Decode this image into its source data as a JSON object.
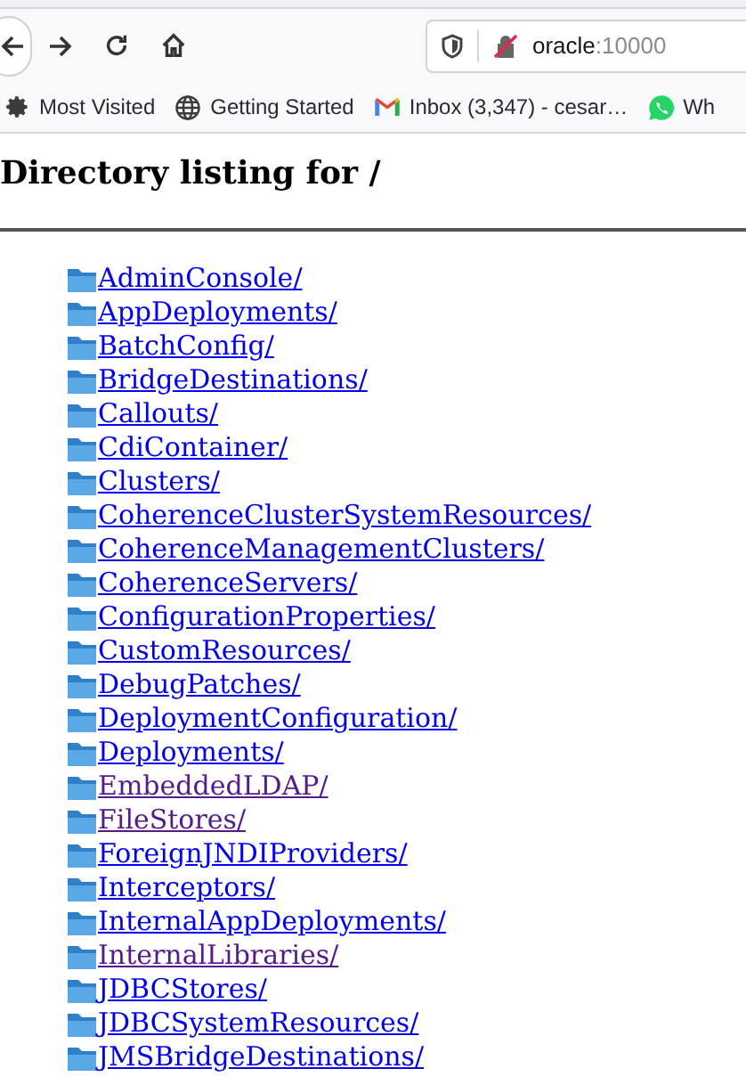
{
  "address_bar": {
    "host": "oracle",
    "port": ":10000"
  },
  "bookmarks": [
    {
      "kind": "gear",
      "label": "Most Visited"
    },
    {
      "kind": "globe",
      "label": "Getting Started"
    },
    {
      "kind": "mail",
      "label": "Inbox (3,347) - cesar…"
    },
    {
      "kind": "chat",
      "label": "Wh"
    }
  ],
  "heading": "Directory listing for /",
  "entries": [
    {
      "name": "AdminConsole/",
      "visited": false
    },
    {
      "name": "AppDeployments/",
      "visited": false
    },
    {
      "name": "BatchConfig/",
      "visited": false
    },
    {
      "name": "BridgeDestinations/",
      "visited": false
    },
    {
      "name": "Callouts/",
      "visited": false
    },
    {
      "name": "CdiContainer/",
      "visited": false
    },
    {
      "name": "Clusters/",
      "visited": false
    },
    {
      "name": "CoherenceClusterSystemResources/",
      "visited": false
    },
    {
      "name": "CoherenceManagementClusters/",
      "visited": false
    },
    {
      "name": "CoherenceServers/",
      "visited": false
    },
    {
      "name": "ConfigurationProperties/",
      "visited": false
    },
    {
      "name": "CustomResources/",
      "visited": false
    },
    {
      "name": "DebugPatches/",
      "visited": false
    },
    {
      "name": "DeploymentConfiguration/",
      "visited": false
    },
    {
      "name": "Deployments/",
      "visited": false
    },
    {
      "name": "EmbeddedLDAP/",
      "visited": true
    },
    {
      "name": "FileStores/",
      "visited": true
    },
    {
      "name": "ForeignJNDIProviders/",
      "visited": false
    },
    {
      "name": "Interceptors/",
      "visited": false
    },
    {
      "name": "InternalAppDeployments/",
      "visited": false
    },
    {
      "name": "InternalLibraries/",
      "visited": true
    },
    {
      "name": "JDBCStores/",
      "visited": false
    },
    {
      "name": "JDBCSystemResources/",
      "visited": false
    },
    {
      "name": "JMSBridgeDestinations/",
      "visited": false
    }
  ]
}
